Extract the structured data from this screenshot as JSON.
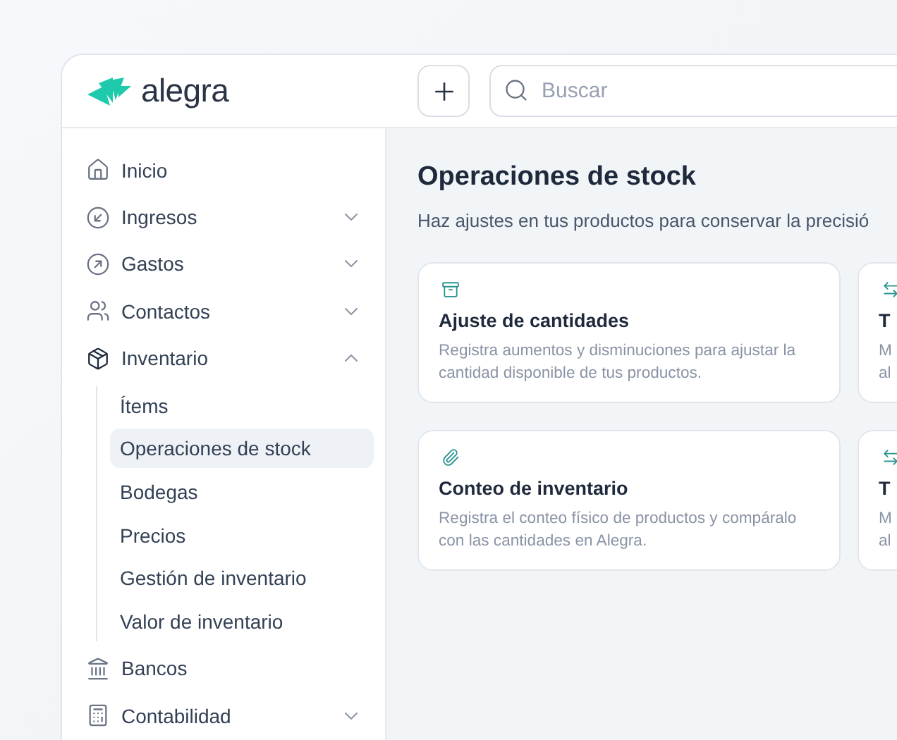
{
  "logo": {
    "text": "alegra"
  },
  "header": {
    "search": {
      "placeholder": "Buscar"
    }
  },
  "sidebar": {
    "items": [
      {
        "label": "Inicio"
      },
      {
        "label": "Ingresos",
        "expanded": false
      },
      {
        "label": "Gastos",
        "expanded": false
      },
      {
        "label": "Contactos",
        "expanded": false
      },
      {
        "label": "Inventario",
        "expanded": true,
        "children": [
          {
            "label": "Ítems",
            "selected": false
          },
          {
            "label": "Operaciones de stock",
            "selected": true
          },
          {
            "label": "Bodegas",
            "selected": false
          },
          {
            "label": "Precios",
            "selected": false
          },
          {
            "label": "Gestión de inventario",
            "selected": false
          },
          {
            "label": "Valor de inventario",
            "selected": false
          }
        ]
      },
      {
        "label": "Bancos"
      },
      {
        "label": "Contabilidad",
        "expanded": false
      }
    ]
  },
  "page": {
    "title": "Operaciones de stock",
    "subtitle": "Haz ajustes en tus productos para conservar la precisió"
  },
  "cards": [
    {
      "title": "Ajuste de cantidades",
      "description": "Registra aumentos y disminuciones para ajustar la cantidad disponible de tus productos."
    },
    {
      "title": "T",
      "description": "M\nal"
    },
    {
      "title": "Conteo de inventario",
      "description": "Registra el conteo físico de productos y compáralo con las cantidades en Alegra."
    },
    {
      "title": "T",
      "description": "M\nal"
    }
  ]
}
